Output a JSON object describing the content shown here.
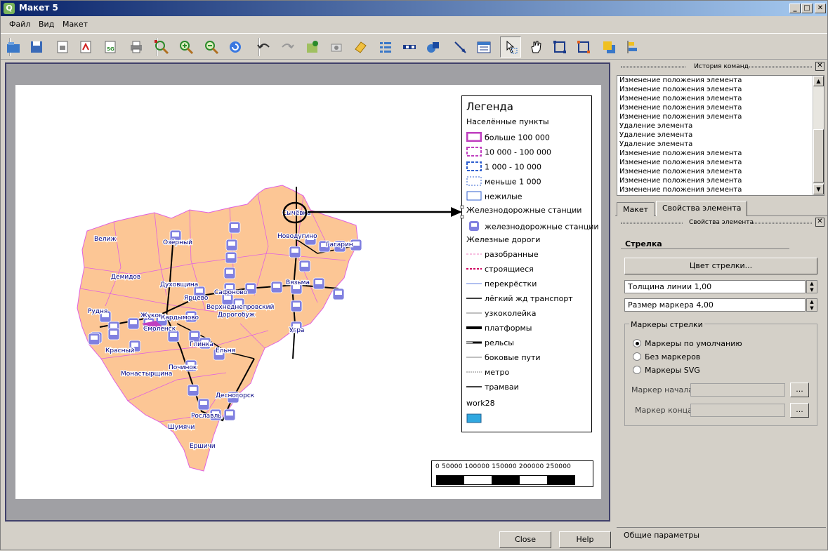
{
  "window": {
    "title": "Макет 5",
    "minimize": "_",
    "maximize": "□",
    "close": "✕"
  },
  "menu": [
    "Файл",
    "Вид",
    "Макет"
  ],
  "toolbar": [
    "open-icon",
    "save-icon",
    "export-image-icon",
    "export-pdf-icon",
    "export-svg-icon",
    "print-icon",
    "zoom-full-icon",
    "zoom-in-icon",
    "zoom-out-icon",
    "refresh-icon",
    "undo-icon",
    "redo-icon",
    "add-map-icon",
    "add-image-icon",
    "add-label-icon",
    "add-legend-icon",
    "add-scalebar-icon",
    "add-shape-icon",
    "add-arrow-icon",
    "add-table-icon",
    "select-move-icon",
    "move-content-icon",
    "group-icon",
    "ungroup-icon",
    "raise-icon",
    "align-icon"
  ],
  "map_labels": [
    "Велиж",
    "Озёрный",
    "Демидов",
    "Духовщина",
    "Рудня",
    "Жуков",
    "Кардымово",
    "Смоленск",
    "Ярцево",
    "Сафоново",
    "Верхнеднепровский",
    "Дорогобуж",
    "Вязьма",
    "Новодугино",
    "Сычёвка",
    "Гагарин",
    "Угра",
    "Глинка",
    "Ельня",
    "Красный",
    "Монастырщина",
    "Починок",
    "Десногорск",
    "Рославль",
    "Шумячи",
    "Ершичи"
  ],
  "legend": {
    "title": "Легенда",
    "items": [
      {
        "label": "Населённые пункты",
        "sym": "none"
      },
      {
        "label": "больше 100 000",
        "sym": "box-thick"
      },
      {
        "label": "10 000 - 100 000",
        "sym": "box-dash-purple"
      },
      {
        "label": "1 000 - 10 000",
        "sym": "box-dash-blue"
      },
      {
        "label": "меньше 1 000",
        "sym": "box-dot-blue"
      },
      {
        "label": "нежилые",
        "sym": "box-thin"
      },
      {
        "label": "Железнодорожные станции",
        "sym": "none"
      },
      {
        "label": "железнодорожные станции",
        "sym": "station"
      },
      {
        "label": "Железные дороги",
        "sym": "none"
      },
      {
        "label": "разобранные",
        "sym": "line-pink-dash"
      },
      {
        "label": "строящиеся",
        "sym": "line-red-dash"
      },
      {
        "label": "перекрёстки",
        "sym": "line-blue"
      },
      {
        "label": "лёгкий жд транспорт",
        "sym": "line-black"
      },
      {
        "label": "узкоколейка",
        "sym": "line-gray"
      },
      {
        "label": "платформы",
        "sym": "line-thick"
      },
      {
        "label": "рельсы",
        "sym": "line-rails"
      },
      {
        "label": "боковые пути",
        "sym": "line-gray"
      },
      {
        "label": "метро",
        "sym": "line-dot"
      },
      {
        "label": "трамваи",
        "sym": "line-black"
      },
      {
        "label": "work28",
        "sym": "none"
      },
      {
        "label": "",
        "sym": "fill-cyan"
      }
    ]
  },
  "scalebar": {
    "labels": "0    50000   100000   150000   200000   250000"
  },
  "buttons": {
    "close": "Close",
    "help": "Help"
  },
  "history": {
    "title": "История команд",
    "items": [
      "Изменение положения элемента",
      "Изменение положения элемента",
      "Изменение положения элемента",
      "Изменение положения элемента",
      "Изменение положения элемента",
      "Удаление элемента",
      "Удаление элемента",
      "Удаление элемента",
      "Изменение положения элемента",
      "Изменение положения элемента",
      "Изменение положения элемента",
      "Изменение положения элемента",
      "Изменение положения элемента"
    ]
  },
  "tabs": [
    "Макет",
    "Свойства элемента"
  ],
  "props": {
    "title": "Свойства элемента",
    "section": "Стрелка",
    "color_button": "Цвет стрелки...",
    "line_width": "Толщина линии 1,00",
    "marker_size": "Размер маркера 4,00",
    "markers_group": "Маркеры стрелки",
    "radio_default": "Маркеры по умолчанию",
    "radio_none": "Без маркеров",
    "radio_svg": "Маркеры SVG",
    "start_marker": "Маркер начала",
    "end_marker": "Маркер конца",
    "browse": "..."
  },
  "footer": "Общие параметры",
  "colors": {
    "map_fill": "#fcc695",
    "boundary": "#e060e0",
    "station": "#8080e0",
    "label": "#000080"
  }
}
